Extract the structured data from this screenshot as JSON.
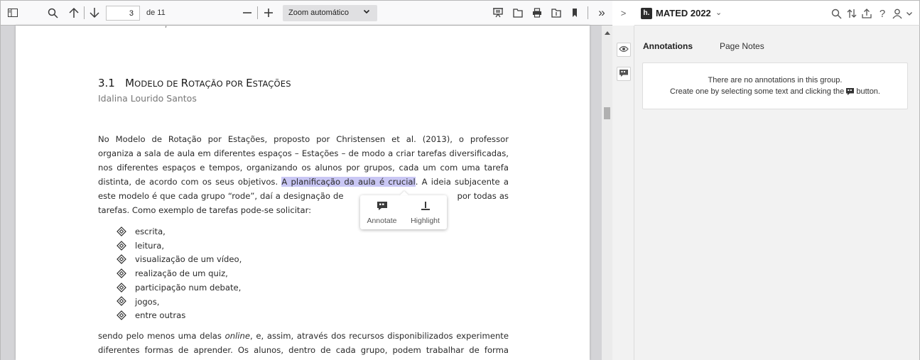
{
  "pdf_toolbar": {
    "page_number": "3",
    "page_of": "de 11",
    "zoom_label": "Zoom automático",
    "overflow_label": "»"
  },
  "document": {
    "section_number": "3.1",
    "section_title_initial_1": "M",
    "section_title_rest_1": "ODELO DE ",
    "section_title_initial_2": "R",
    "section_title_rest_2": "OTAÇÃO POR ",
    "section_title_initial_3": "E",
    "section_title_rest_3": "STAÇÕES",
    "author": "Idalina Lourido Santos",
    "para1_lines": [
      "No Modelo de Rotação por Estações, proposto por Christensen et al. (2013), o professor",
      "organiza a sala de aula em diferentes espaços – Estações – de modo a criar tarefas diversificadas,",
      "nos diferentes espaços e tempos, organizando os alunos por grupos, cada um com uma tarefa"
    ],
    "para1_line4_before": "distinta, de acordo com os seus objetivos. ",
    "para1_line4_highlight": "A planificação da aula é crucial",
    "para1_line4_after": ". A ideia subjacente a",
    "para1_line5_before": "este modelo é que cada grupo “rode”, daí a designação de ",
    "para1_line5_after": " por todas as",
    "para1_line6": "tarefas. Como exemplo de tarefas pode-se solicitar:",
    "bullets": [
      "escrita,",
      "leitura,",
      "visualização de um vídeo,",
      "realização de um quiz,",
      "participação num debate,",
      "jogos,",
      "entre outras"
    ],
    "para2_line1_before": "sendo pelo menos uma delas ",
    "para2_line1_italic": "online",
    "para2_line1_after": ", e, assim, através dos recursos disponibilizados experimente",
    "para2_line2": "diferentes formas de aprender. Os alunos, dentro de cada grupo, podem trabalhar de forma"
  },
  "adder": {
    "annotate_label": "Annotate",
    "highlight_label": "Highlight"
  },
  "sidebar": {
    "toggle_label": ">",
    "group_name": "MATED 2022",
    "group_caret": "⌄",
    "logo_text": "h.",
    "tabs": [
      "Annotations",
      "Page Notes"
    ],
    "empty_line1": "There are no annotations in this group.",
    "empty_line2_before": "Create one by selecting some text and clicking the",
    "empty_line2_after": "button."
  },
  "colors": {
    "highlight": "#c9c7f4",
    "sidebar_bg": "#f2f2f2",
    "toolbar_bg": "#f9f9fa"
  }
}
